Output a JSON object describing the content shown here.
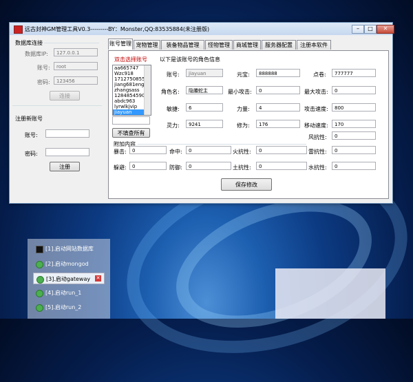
{
  "window": {
    "title": "远古封神GM管理工具V0.3---------BY：Monster,QQ:83535884(未注册版)",
    "min": "–",
    "max": "□",
    "close": "✕"
  },
  "db": {
    "group_title": "数据库连接",
    "ip_label": "数据库IP:",
    "ip_value": "127.0.0.1",
    "user_label": "账号:",
    "user_value": "root",
    "pass_label": "密码:",
    "pass_value": "123456",
    "connect_btn": "连接"
  },
  "register": {
    "group_title": "注册新账号",
    "account_label": "账号:",
    "account_value": "",
    "pass_label": "密码:",
    "pass_value": "",
    "register_btn": "注册"
  },
  "tabs": [
    "账号管理",
    "宠物管理",
    "装备物品管理",
    "怪物管理",
    "商城管理",
    "服务器配置",
    "注册本软件"
  ],
  "account_list": {
    "title": "双击选择账号",
    "items": [
      "aa665747",
      "Wzc918",
      "1712750855",
      "jiang681eng",
      "zhangsass",
      "1284854590",
      "abdc963",
      "lyrwlkjvip",
      "jiayuan"
    ],
    "selected_index": 8,
    "search_value": "",
    "show_all_btn": "不填查所有"
  },
  "role": {
    "section_title": "以下是该账号的角色信息",
    "fields": {
      "account": {
        "label": "账号:",
        "value": "jiayuan"
      },
      "yuanbao": {
        "label": "元宝:",
        "value": "888888"
      },
      "dianjuan": {
        "label": "点卷:",
        "value": "777777"
      },
      "name": {
        "label": "角色名:",
        "value": "隐螣蛇主"
      },
      "min_atk": {
        "label": "最小攻击:",
        "value": "0"
      },
      "max_atk": {
        "label": "最大攻击:",
        "value": "0"
      },
      "agility": {
        "label": "敏捷:",
        "value": "6"
      },
      "strength": {
        "label": "力量:",
        "value": "4"
      },
      "atk_speed": {
        "label": "攻击速度:",
        "value": "800"
      },
      "spirit": {
        "label": "灵力:",
        "value": "9241"
      },
      "cultivation": {
        "label": "修为:",
        "value": "176"
      },
      "move_speed": {
        "label": "移动速度:",
        "value": "170"
      },
      "wind_res": {
        "label": "风抗性:",
        "value": "0"
      }
    },
    "extra_title": "附加内容",
    "extra": {
      "crit": {
        "label": "暴击:",
        "value": "0"
      },
      "hit": {
        "label": "命中:",
        "value": "0"
      },
      "fire_res": {
        "label": "火抗性:",
        "value": "0"
      },
      "thunder_res": {
        "label": "雷抗性:",
        "value": "0"
      },
      "dodge": {
        "label": "躲避:",
        "value": "0"
      },
      "defense": {
        "label": "防御:",
        "value": "0"
      },
      "earth_res": {
        "label": "土抗性:",
        "value": "0"
      },
      "water_res": {
        "label": "水抗性:",
        "value": "0"
      }
    },
    "save_btn": "保存修改"
  },
  "taskbar": {
    "items": [
      {
        "label": "[1].启动网站数据库",
        "icon": "cmd-icon"
      },
      {
        "label": "[2].启动mongod",
        "icon": "play-icon"
      },
      {
        "label": "[3].启动gateway",
        "icon": "play-icon",
        "close": "✕"
      },
      {
        "label": "[4].启动run_1",
        "icon": "play-icon"
      },
      {
        "label": "[5].启动run_2",
        "icon": "play-icon"
      }
    ]
  }
}
